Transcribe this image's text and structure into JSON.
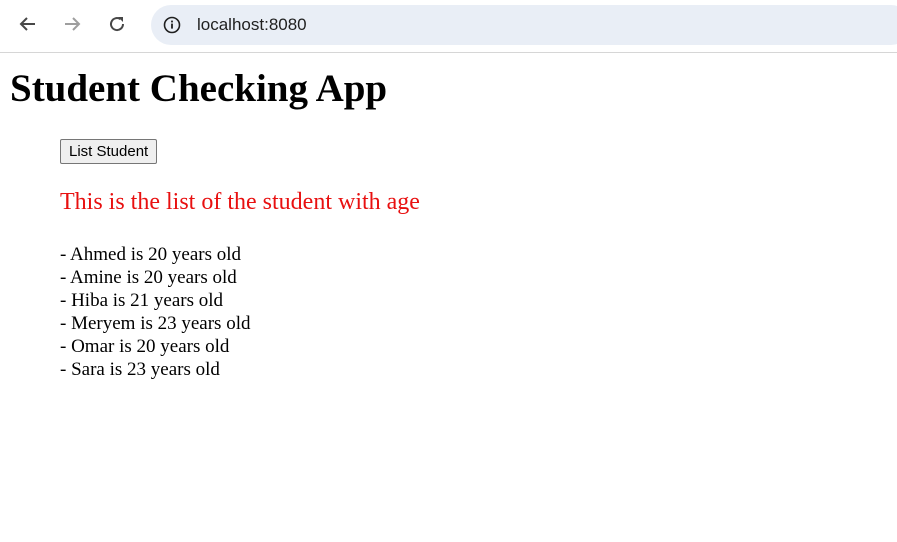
{
  "browser": {
    "url": "localhost:8080",
    "back_icon": "arrow-left-icon",
    "forward_icon": "arrow-right-icon",
    "reload_icon": "reload-icon",
    "site_info_icon": "info-circle-icon"
  },
  "page": {
    "title": "Student Checking App",
    "list_button_label": "List Student",
    "list_heading": "This is the list of the student with age",
    "heading_color": "#e81010",
    "students": [
      "- Ahmed is 20 years old",
      "- Amine is 20 years old",
      "- Hiba is 21 years old",
      "- Meryem is 23 years old",
      "- Omar is 20 years old",
      "- Sara is 23 years old"
    ]
  }
}
